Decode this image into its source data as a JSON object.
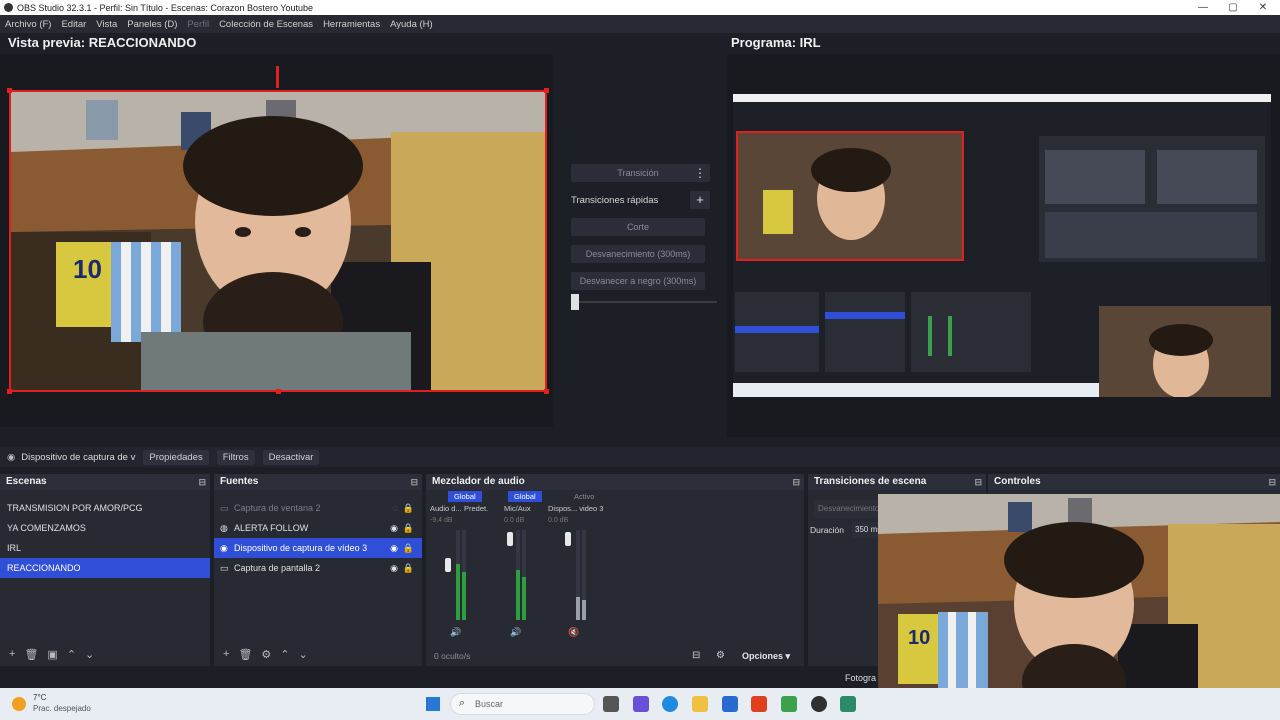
{
  "window": {
    "title": "OBS Studio 32.3.1 - Perfil: Sin Título - Escenas: Corazon Bostero Youtube"
  },
  "menu": [
    "Archivo (F)",
    "Editar",
    "Vista",
    "Paneles (D)",
    "Perfil",
    "Colección de Escenas",
    "Herramientas",
    "Ayuda (H)"
  ],
  "preview": {
    "title": "Vista previa: REACCIONANDO"
  },
  "program": {
    "title": "Programa: IRL"
  },
  "transitions": {
    "transition_label": "Transición",
    "quick_label": "Transiciones rápidas",
    "cut_label": "Corte",
    "fade_label": "Desvanecimiento (300ms)",
    "fade_black_label": "Desvanecer a negro (300ms)"
  },
  "source_bar": {
    "selected_source": "Dispositivo de captura de v",
    "properties": "Propiedades",
    "filters": "Filtros",
    "deactivate": "Desactivar"
  },
  "scenes": {
    "title": "Escenas",
    "items": [
      "TRANSMISION POR AMOR/PCG",
      "YA COMENZAMOS",
      "IRL",
      "REACCIONANDO"
    ],
    "selected_index": 3
  },
  "sources": {
    "title": "Fuentes",
    "items": [
      {
        "name": "Captura de ventana 2",
        "visible": false
      },
      {
        "name": "ALERTA FOLLOW",
        "visible": true
      },
      {
        "name": "Dispositivo de captura de vídeo 3",
        "visible": true
      },
      {
        "name": "Captura de pantalla 2",
        "visible": true
      }
    ],
    "selected_index": 2
  },
  "mixer": {
    "title": "Mezclador de audio",
    "tab_global": "Global",
    "tab_active": "Activo",
    "channels": [
      {
        "name": "Audio d...",
        "device": "Predet.",
        "db": "-9.4 dB",
        "level": 0.62
      },
      {
        "name": "Mic/Aux",
        "device": "",
        "db": "0.0 dB",
        "level": 0.55
      },
      {
        "name": "Dispos... video 3",
        "device": "",
        "db": "0.0 dB",
        "level": 0.25
      }
    ],
    "hidden_label": "0 oculto/s",
    "options_label": "Opciones"
  },
  "scene_transitions": {
    "title": "Transiciones de escena",
    "current": "Desvanecimiento",
    "duration_label": "Duración",
    "duration_value": "350 ms"
  },
  "controls": {
    "title": "Controles",
    "fotograma": "Fotogra"
  },
  "taskbar": {
    "weather_temp": "7°C",
    "weather_desc": "Prac. despejado",
    "search_placeholder": "Buscar"
  },
  "colors": {
    "accent": "#2f4fd8",
    "selection_border": "#e02020"
  }
}
